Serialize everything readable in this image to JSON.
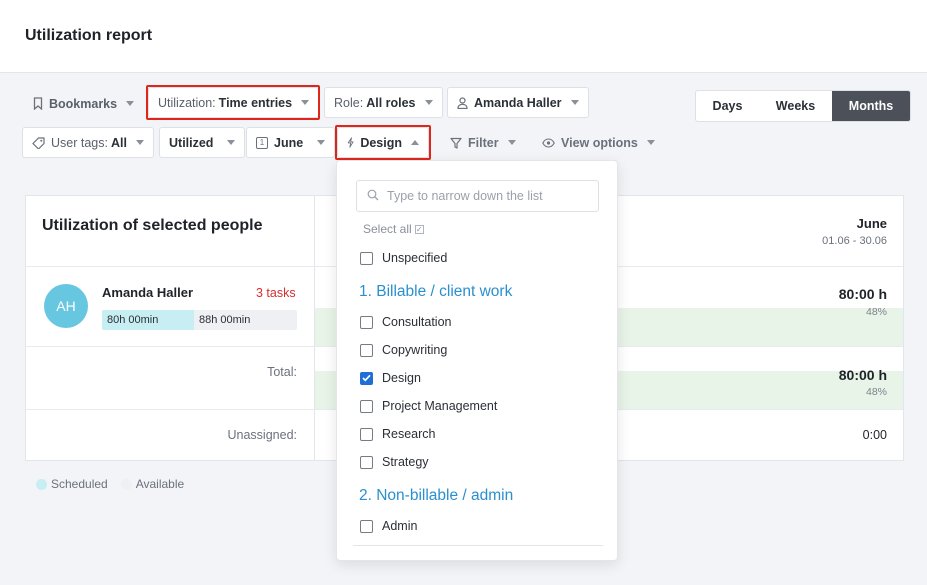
{
  "page": {
    "title": "Utilization report"
  },
  "toolbar": {
    "bookmarks": "Bookmarks",
    "utilization_label": "Utilization:",
    "utilization_value": "Time entries",
    "role_label": "Role:",
    "role_value": "All roles",
    "person": "Amanda Haller",
    "user_tags_label": "User tags:",
    "user_tags_value": "All",
    "utilized": "Utilized",
    "month": "June",
    "month_icon_text": "1",
    "design": "Design",
    "filter": "Filter",
    "view_options": "View options",
    "range_options": [
      "Days",
      "Weeks",
      "Months"
    ],
    "range_selected": "Months",
    "highlight_color": "#e0261b"
  },
  "card": {
    "title": "Utilization of selected people",
    "month": "June",
    "month_range": "01.06 - 30.06",
    "person": {
      "initials": "AH",
      "name": "Amanda Haller",
      "tasks": "3 tasks",
      "scheduled": "80h 00min",
      "available": "88h 00min",
      "scheduled_fraction": 0.47,
      "hours": "80:00 h",
      "percent": "48%"
    },
    "total": {
      "label": "Total:",
      "hours": "80:00 h",
      "percent": "48%"
    },
    "unassigned": {
      "label": "Unassigned:",
      "hours": "0:00"
    }
  },
  "legend": {
    "scheduled": "Scheduled",
    "available": "Available",
    "scheduled_color": "#c7eef2",
    "available_color": "#eef0f4"
  },
  "dropdown": {
    "search_placeholder": "Type to narrow down the list",
    "select_all": "Select all",
    "unspecified": "Unspecified",
    "groups": [
      {
        "title": "1. Billable / client work",
        "items": [
          {
            "label": "Consultation",
            "checked": false
          },
          {
            "label": "Copywriting",
            "checked": false
          },
          {
            "label": "Design",
            "checked": true
          },
          {
            "label": "Project Management",
            "checked": false
          },
          {
            "label": "Research",
            "checked": false
          },
          {
            "label": "Strategy",
            "checked": false
          }
        ]
      },
      {
        "title": "2. Non-billable / admin",
        "items": [
          {
            "label": "Admin",
            "checked": false
          }
        ]
      }
    ]
  }
}
